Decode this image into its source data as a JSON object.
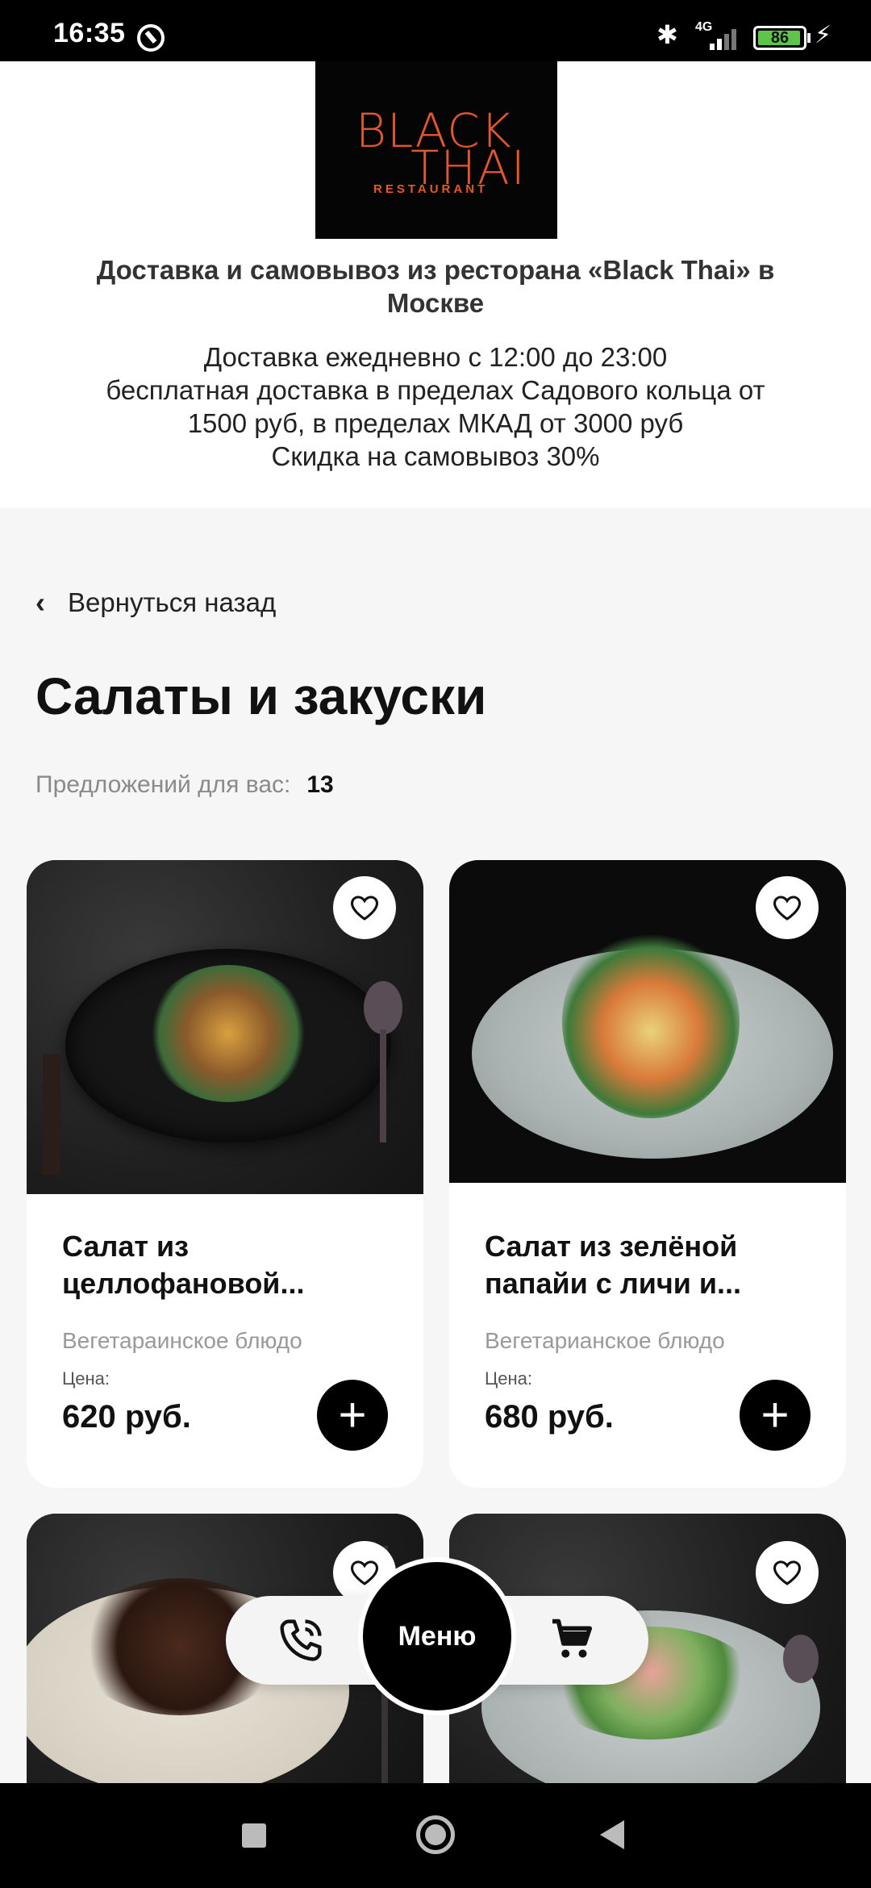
{
  "status_bar": {
    "time": "16:35",
    "network": "4G",
    "battery": "86"
  },
  "header": {
    "logo": {
      "line1": "BLACK",
      "line2": "THAI",
      "line3": "RESTAURANT"
    },
    "title": "Доставка и самовывоз из ресторана «Black Thai» в Москве",
    "info_lines": [
      "Доставка ежедневно с 12:00 до 23:00",
      "бесплатная доставка в пределах Садового кольца от",
      "1500 руб, в пределах МКАД от 3000 руб",
      "Скидка на самовывоз 30%"
    ]
  },
  "back_link": {
    "label": "Вернуться назад"
  },
  "category": {
    "title": "Салаты и закуски",
    "offers_label": "Предложений для вас:",
    "offers_count": "13"
  },
  "products": [
    {
      "name": "Салат из целлофановой...",
      "tag": "Вегетараинское блюдо",
      "price_label": "Цена:",
      "price": "620 руб."
    },
    {
      "name": "Салат из зелёной папайи с личи и...",
      "tag": "Вегетарианское блюдо",
      "price_label": "Цена:",
      "price": "680 руб."
    },
    {
      "name": "",
      "tag": "",
      "price_label": "",
      "price": ""
    },
    {
      "name": "",
      "tag": "",
      "price_label": "",
      "price": ""
    }
  ],
  "floating_nav": {
    "menu_label": "Меню"
  },
  "icons": {
    "heart": "heart-icon",
    "add": "plus-icon",
    "phone": "phone-icon",
    "cart": "cart-icon",
    "back": "chevron-left-icon"
  }
}
